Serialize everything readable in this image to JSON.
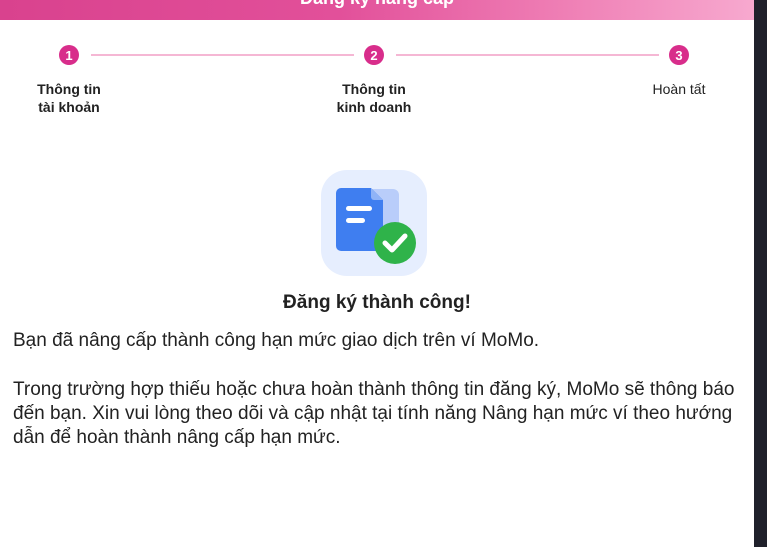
{
  "header": {
    "title": "Đăng ký nâng cấp"
  },
  "stepper": {
    "steps": [
      {
        "number": "1",
        "label_line1": "Thông tin",
        "label_line2": "tài khoản"
      },
      {
        "number": "2",
        "label_line1": "Thông tin",
        "label_line2": "kinh doanh"
      },
      {
        "number": "3",
        "label_line1": "Hoàn tất",
        "label_line2": ""
      }
    ]
  },
  "result": {
    "title": "Đăng ký thành công!",
    "message_1": "Bạn đã nâng cấp thành công hạn mức giao dịch trên ví MoMo.",
    "message_2": "Trong trường hợp thiếu hoặc chưa hoàn thành thông tin đăng ký, MoMo sẽ thông báo đến bạn. Xin vui lòng theo dõi và cập nhật tại tính năng Nâng hạn mức ví theo hướng dẫn để hoàn thành nâng cấp hạn mức."
  },
  "colors": {
    "accent": "#d82d8b",
    "step_line": "#f5b7d4",
    "doc_blue": "#3f7ef0",
    "check_green": "#2fb34a"
  },
  "icons": {
    "illustration": "document-check-icon"
  }
}
